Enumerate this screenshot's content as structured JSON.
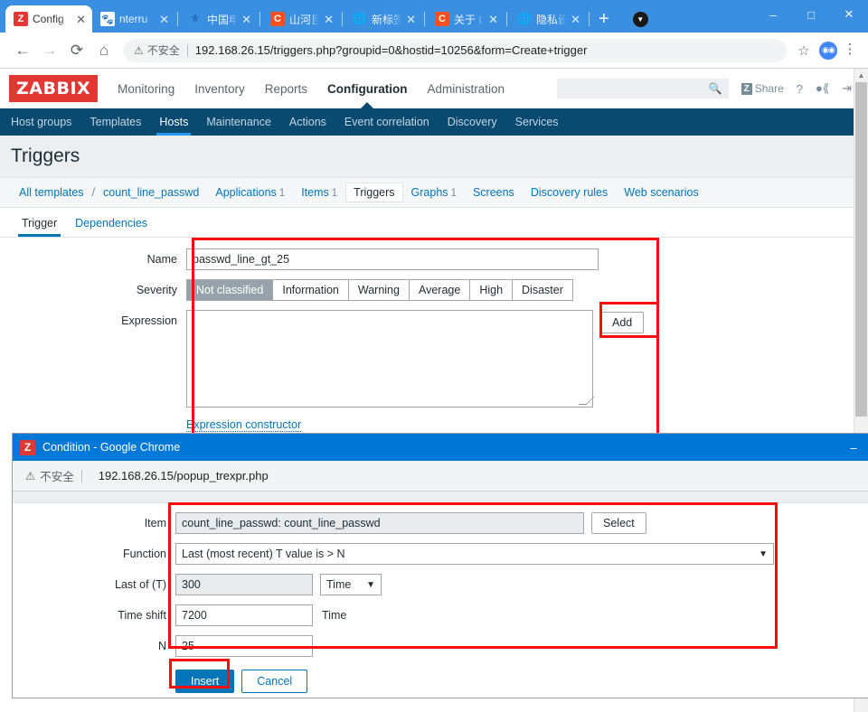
{
  "browser": {
    "tabs": [
      {
        "label": "Config",
        "favicon": "zabbix-icon",
        "active": true
      },
      {
        "label": "nterru",
        "favicon": "baidu-icon",
        "active": false
      },
      {
        "label": "中国电",
        "favicon": "telecom-icon",
        "active": false
      },
      {
        "label": "山河巨",
        "favicon": "c-orange-icon",
        "active": false
      },
      {
        "label": "新标签",
        "favicon": "globe-icon",
        "active": false
      },
      {
        "label": "关于 L",
        "favicon": "c-orange-icon",
        "active": false
      },
      {
        "label": "隐私设",
        "favicon": "globe-icon",
        "active": false
      }
    ],
    "new_tab_label": "+",
    "window_controls": {
      "minimize": "–",
      "maximize": "□",
      "close": "✕"
    },
    "toolbar": {
      "back": "←",
      "forward": "→",
      "reload": "⟳",
      "home": "⌂",
      "security_label": "不安全",
      "url": "192.168.26.15/triggers.php?groupid=0&hostid=10256&form=Create+trigger",
      "bookmark": "☆",
      "menu": "⋮"
    }
  },
  "zabbix": {
    "logo": "ZABBIX",
    "main_nav": [
      {
        "label": "Monitoring",
        "selected": false
      },
      {
        "label": "Inventory",
        "selected": false
      },
      {
        "label": "Reports",
        "selected": false
      },
      {
        "label": "Configuration",
        "selected": true
      },
      {
        "label": "Administration",
        "selected": false
      }
    ],
    "search_placeholder": "",
    "share_label": "Share",
    "share_badge": "Z",
    "help_label": "?",
    "sub_nav": [
      {
        "label": "Host groups",
        "selected": false
      },
      {
        "label": "Templates",
        "selected": false
      },
      {
        "label": "Hosts",
        "selected": true
      },
      {
        "label": "Maintenance",
        "selected": false
      },
      {
        "label": "Actions",
        "selected": false
      },
      {
        "label": "Event correlation",
        "selected": false
      },
      {
        "label": "Discovery",
        "selected": false
      },
      {
        "label": "Services",
        "selected": false
      }
    ],
    "page_title": "Triggers",
    "breadcrumb": [
      {
        "label": "All templates",
        "count": "",
        "current": false
      },
      {
        "label": "count_line_passwd",
        "count": "",
        "current": false
      },
      {
        "label": "Applications",
        "count": "1",
        "current": false
      },
      {
        "label": "Items",
        "count": "1",
        "current": false
      },
      {
        "label": "Triggers",
        "count": "",
        "current": true
      },
      {
        "label": "Graphs",
        "count": "1",
        "current": false
      },
      {
        "label": "Screens",
        "count": "",
        "current": false
      },
      {
        "label": "Discovery rules",
        "count": "",
        "current": false
      },
      {
        "label": "Web scenarios",
        "count": "",
        "current": false
      }
    ],
    "breadcrumb_slash": "/",
    "form_tabs": [
      {
        "label": "Trigger",
        "selected": true
      },
      {
        "label": "Dependencies",
        "selected": false
      }
    ],
    "form": {
      "name_label": "Name",
      "name_value": "passwd_line_gt_25",
      "severity_label": "Severity",
      "severity_options": [
        {
          "label": "Not classified",
          "selected": true
        },
        {
          "label": "Information",
          "selected": false
        },
        {
          "label": "Warning",
          "selected": false
        },
        {
          "label": "Average",
          "selected": false
        },
        {
          "label": "High",
          "selected": false
        },
        {
          "label": "Disaster",
          "selected": false
        }
      ],
      "expression_label": "Expression",
      "expression_value": "",
      "add_button": "Add",
      "expression_constructor_link": "Expression constructor"
    }
  },
  "popup": {
    "window_title": "Condition - Google Chrome",
    "window_icon": "Z",
    "minimize": "–",
    "security_label": "不安全",
    "url": "192.168.26.15/popup_trexpr.php",
    "form": {
      "item_label": "Item",
      "item_value": "count_line_passwd: count_line_passwd",
      "select_button": "Select",
      "function_label": "Function",
      "function_value": "Last (most recent) T value is > N",
      "last_of_t_label": "Last of (T)",
      "last_of_t_value": "300",
      "last_of_t_unit": "Time",
      "time_shift_label": "Time shift",
      "time_shift_value": "7200",
      "time_shift_unit": "Time",
      "n_label": "N",
      "n_value": "25",
      "insert_button": "Insert",
      "cancel_button": "Cancel"
    }
  },
  "colors": {
    "accent": "#0275b8",
    "annotation": "#fb0d0d",
    "zabbix_red": "#e33734",
    "nav_dark": "#0a4a70",
    "chrome_blue": "#0078d7"
  }
}
